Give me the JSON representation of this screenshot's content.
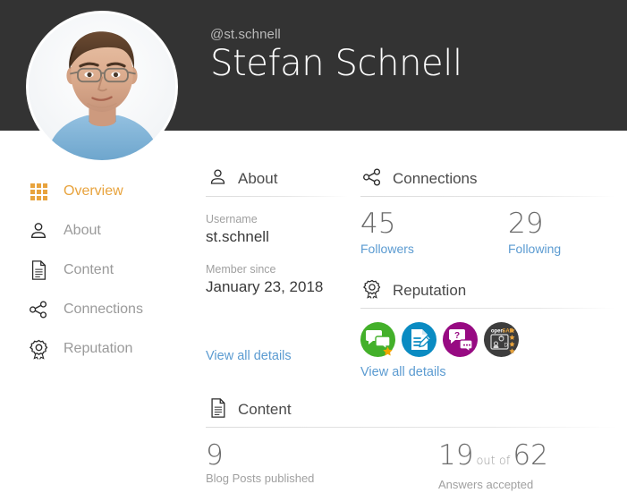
{
  "profile": {
    "handle": "@st.schnell",
    "full_name": "Stefan Schnell",
    "avatar_alt": "profile-photo"
  },
  "sidebar": {
    "items": [
      {
        "label": "Overview",
        "icon": "grid-icon",
        "active": true
      },
      {
        "label": "About",
        "icon": "person-icon",
        "active": false
      },
      {
        "label": "Content",
        "icon": "document-icon",
        "active": false
      },
      {
        "label": "Connections",
        "icon": "share-nodes-icon",
        "active": false
      },
      {
        "label": "Reputation",
        "icon": "award-badge-icon",
        "active": false
      }
    ]
  },
  "about": {
    "heading": "About",
    "heading_icon": "person-icon",
    "username_label": "Username",
    "username_value": "st.schnell",
    "member_since_label": "Member since",
    "member_since_value": "January 23, 2018",
    "view_all_link": "View all details"
  },
  "connections": {
    "heading": "Connections",
    "heading_icon": "share-nodes-icon",
    "followers_count": "45",
    "followers_label": "Followers",
    "following_count": "29",
    "following_label": "Following"
  },
  "reputation": {
    "heading": "Reputation",
    "heading_icon": "award-badge-icon",
    "view_all_link": "View all details",
    "badges": [
      {
        "name": "community-chat-badge",
        "color": "#43b02a",
        "icon": "speech-bubbles-star-icon"
      },
      {
        "name": "blog-author-badge",
        "color": "#0a8bc2",
        "icon": "document-pencil-icon"
      },
      {
        "name": "question-answer-badge",
        "color": "#970a82",
        "icon": "question-bubbles-icon"
      },
      {
        "name": "opensap-badge",
        "color": "#3d3d3d",
        "icon": "opensap-stars-icon",
        "text": "openSAP"
      }
    ]
  },
  "content": {
    "heading": "Content",
    "heading_icon": "document-icon",
    "blog_posts_count": "9",
    "blog_posts_label": "Blog Posts published",
    "answers_accepted_count": "19",
    "answers_out_of_word": "out of",
    "answers_total": "62",
    "answers_label": "Answers accepted"
  },
  "colors": {
    "header_bg": "#333333",
    "accent": "#e8a33d",
    "link": "#5b9bd1",
    "muted_text": "#9a9a9a"
  }
}
